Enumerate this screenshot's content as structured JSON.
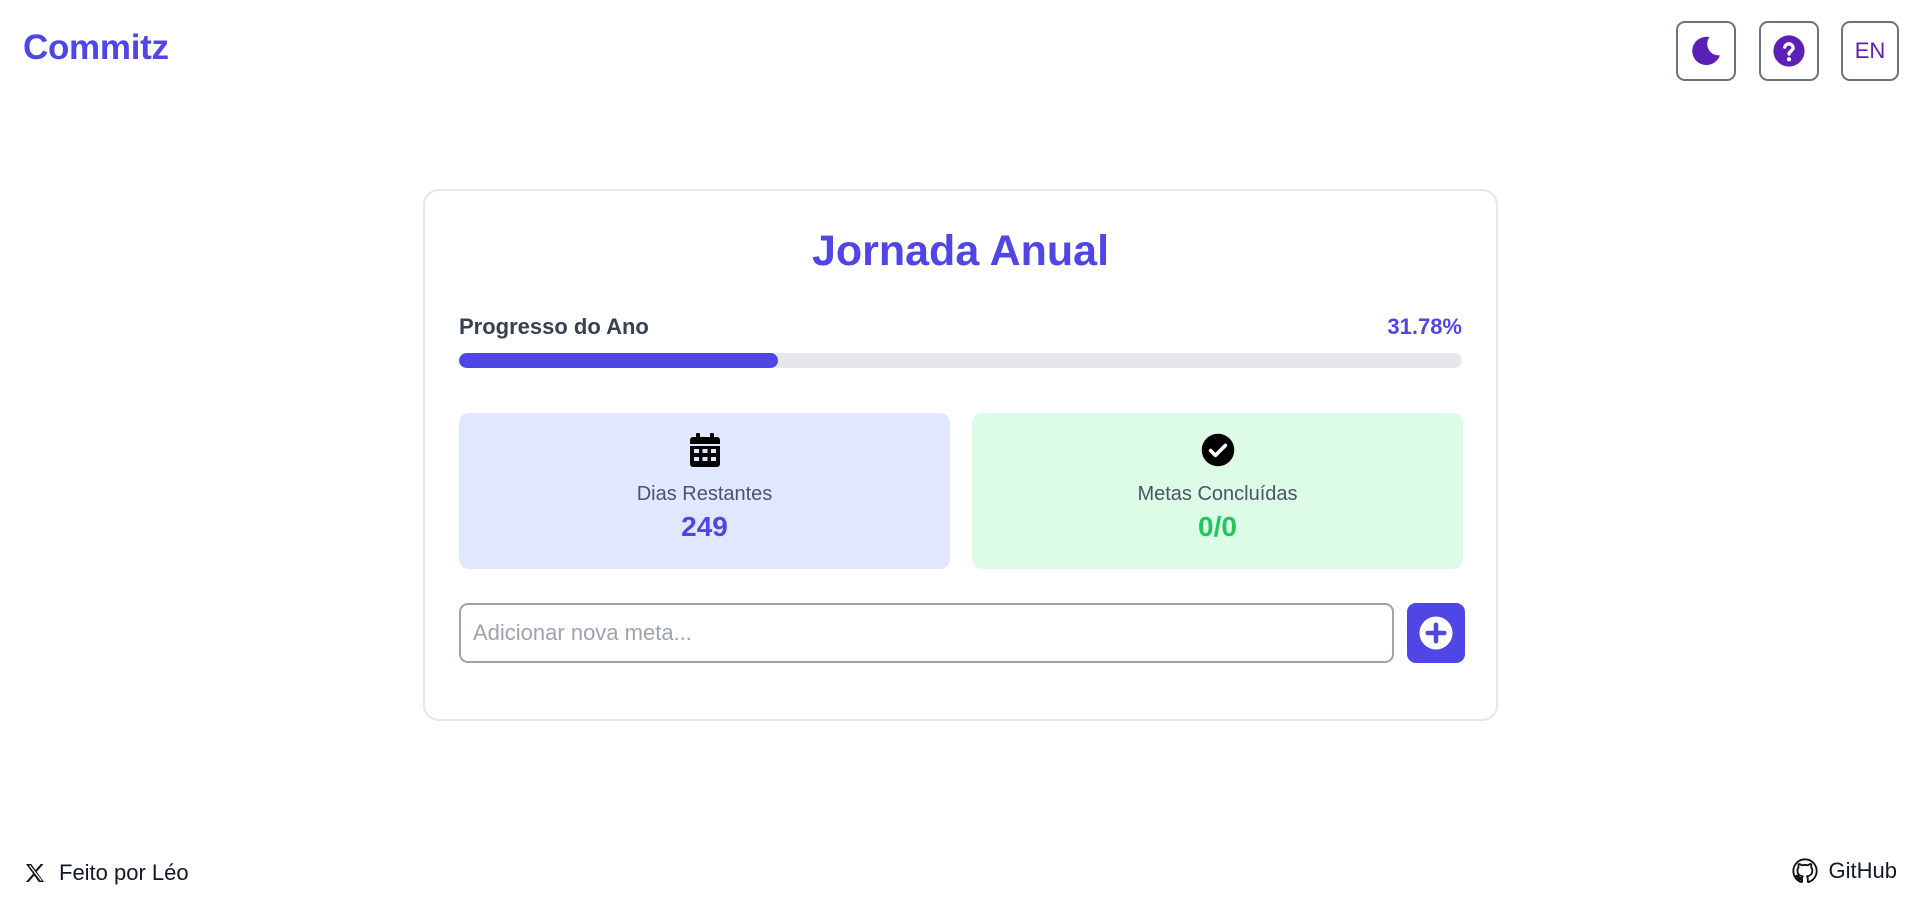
{
  "header": {
    "logo": "Commitz",
    "theme_icon": "moon-icon",
    "help_icon": "question-circle-icon",
    "language_button": "EN"
  },
  "card": {
    "title": "Jornada Anual",
    "progress": {
      "label": "Progresso do Ano",
      "percent_text": "31.78%",
      "percent_value": 31.78
    },
    "stats": {
      "days_remaining": {
        "icon": "calendar-icon",
        "label": "Dias Restantes",
        "value": "249"
      },
      "goals_completed": {
        "icon": "check-circle-icon",
        "label": "Metas Concluídas",
        "value": "0/0"
      }
    },
    "goal_input": {
      "placeholder": "Adicionar nova meta...",
      "value": ""
    },
    "add_button_icon": "plus-circle-icon"
  },
  "footer": {
    "credit_text": "Feito por Léo",
    "credit_icon": "x-logo-icon",
    "github_text": "GitHub",
    "github_icon": "github-icon"
  },
  "colors": {
    "primary": "#4f46e5",
    "accent_purple": "#5b21b6",
    "success": "#22c55e",
    "days_bg": "#e0e7ff",
    "goals_bg": "#dcfce7"
  }
}
